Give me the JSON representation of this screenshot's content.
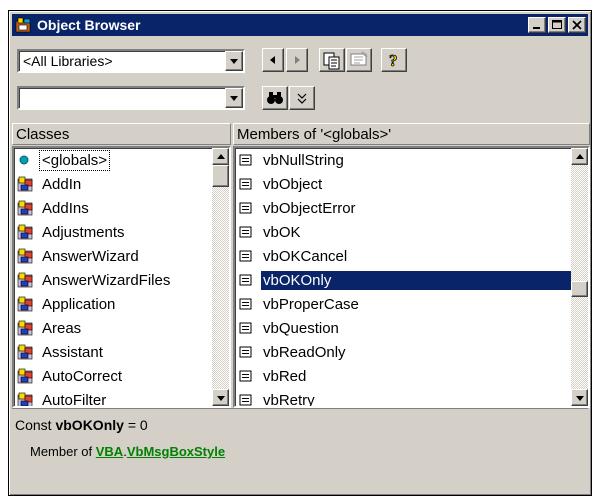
{
  "window": {
    "title": "Object Browser"
  },
  "toolbar": {
    "library_combo_value": "<All Libraries>",
    "search_combo_value": ""
  },
  "classes": {
    "header": "Classes",
    "items": [
      "<globals>",
      "AddIn",
      "AddIns",
      "Adjustments",
      "AnswerWizard",
      "AnswerWizardFiles",
      "Application",
      "Areas",
      "Assistant",
      "AutoCorrect",
      "AutoFilter"
    ]
  },
  "members": {
    "header": "Members of '<globals>'",
    "items": [
      "vbNullString",
      "vbObject",
      "vbObjectError",
      "vbOK",
      "vbOKCancel",
      "vbOKOnly",
      "vbProperCase",
      "vbQuestion",
      "vbReadOnly",
      "vbRed",
      "vbRetry"
    ],
    "selected": "vbOKOnly"
  },
  "details": {
    "decl_prefix": "Const ",
    "decl_name": "vbOKOnly",
    "decl_suffix": " = 0",
    "member_of_label": "Member of ",
    "library_link": "VBA",
    "separator": ".",
    "class_link": "VbMsgBoxStyle"
  },
  "colors": {
    "selection": "#0a246a",
    "link": "#008000",
    "face": "#d4d0c8"
  }
}
